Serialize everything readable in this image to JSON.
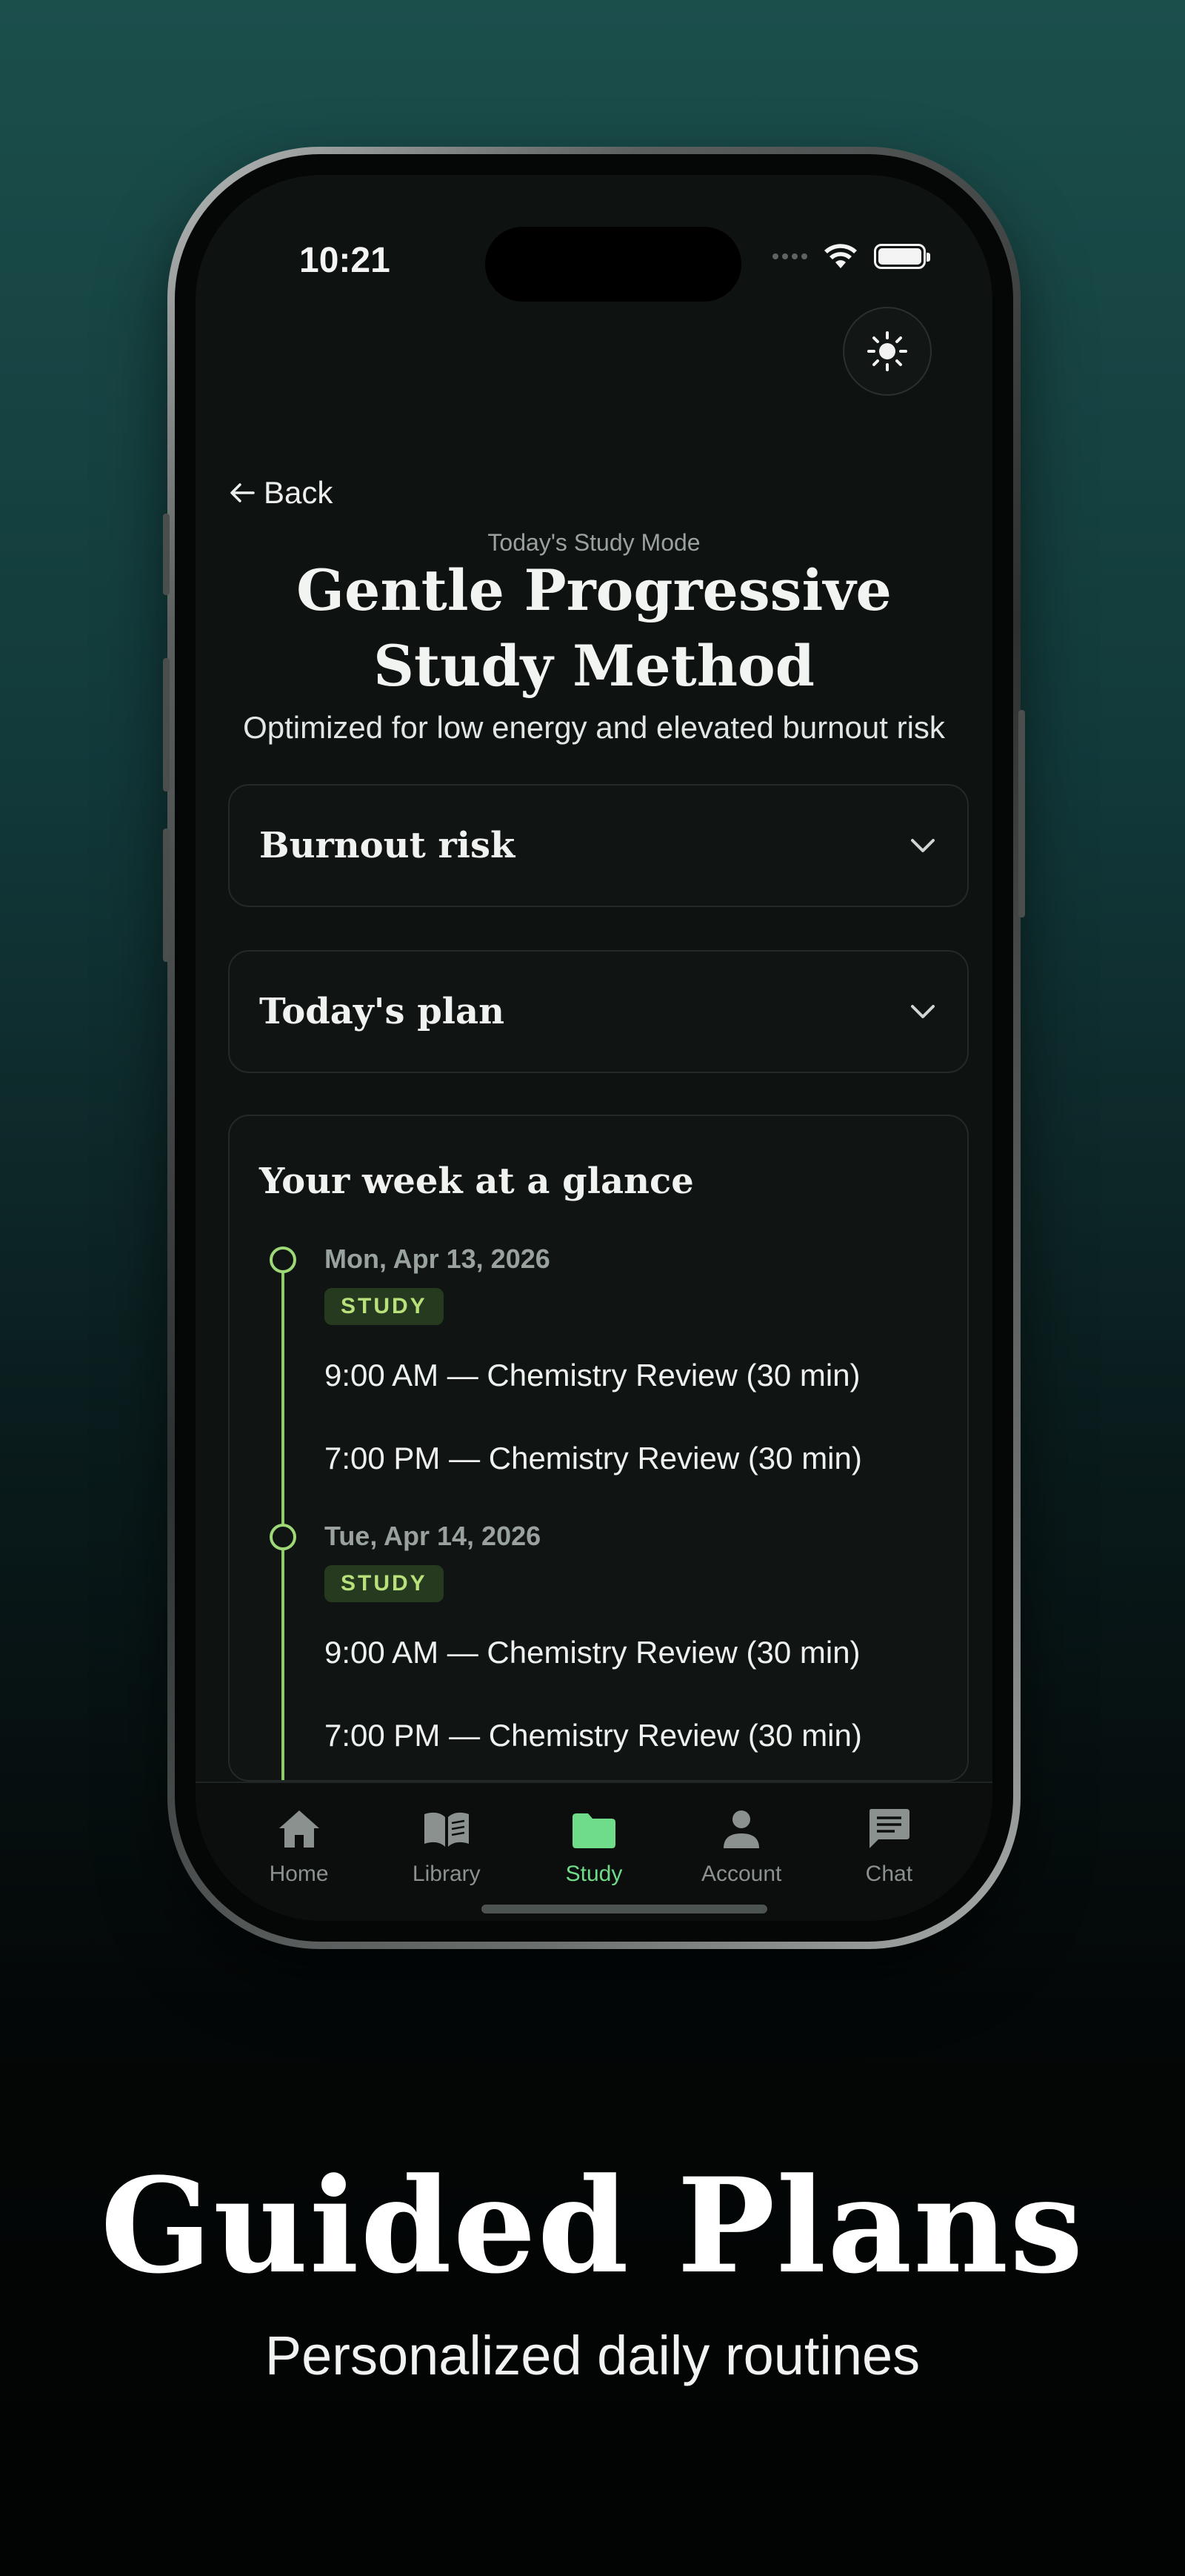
{
  "status_bar": {
    "time": "10:21"
  },
  "header": {
    "back_label": "Back",
    "mode_label": "Today's Study Mode",
    "title_line1": "Gentle Progressive",
    "title_line2": "Study Method",
    "subtitle": "Optimized for low energy and elevated burnout risk"
  },
  "sections": {
    "burnout": {
      "title": "Burnout risk"
    },
    "plan": {
      "title": "Today's plan"
    }
  },
  "week": {
    "title": "Your week at a glance",
    "days": [
      {
        "date": "Mon, Apr 13, 2026",
        "badge": "STUDY",
        "sessions": [
          "9:00 AM — Chemistry Review (30 min)",
          "7:00 PM — Chemistry Review (30 min)"
        ]
      },
      {
        "date": "Tue, Apr 14, 2026",
        "badge": "STUDY",
        "sessions": [
          "9:00 AM — Chemistry Review (30 min)",
          "7:00 PM — Chemistry Review (30 min)"
        ]
      }
    ]
  },
  "tabs": [
    {
      "label": "Home",
      "icon": "home-icon"
    },
    {
      "label": "Library",
      "icon": "book-icon"
    },
    {
      "label": "Study",
      "icon": "folder-icon",
      "active": true
    },
    {
      "label": "Account",
      "icon": "person-icon"
    },
    {
      "label": "Chat",
      "icon": "chat-icon"
    }
  ],
  "colors": {
    "accent": "#6fdc8a",
    "timeline": "#8fcc6a",
    "badge_text": "#b8e07b"
  },
  "caption": {
    "title": "Guided Plans",
    "subtitle": "Personalized daily routines"
  }
}
